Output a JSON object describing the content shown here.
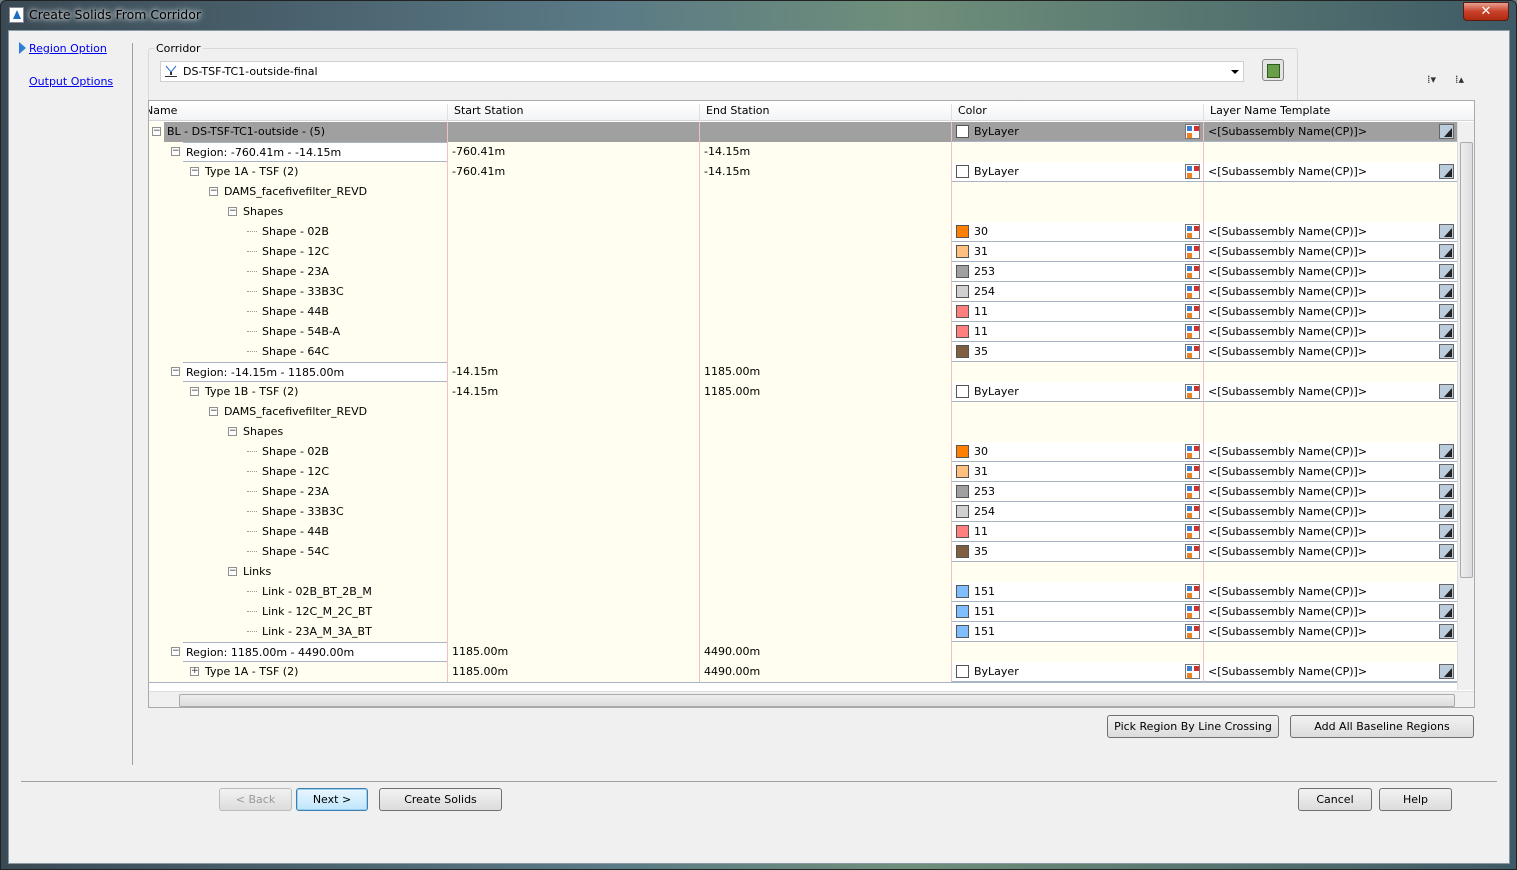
{
  "window": {
    "title": "Create Solids From Corridor",
    "close_label": "✕"
  },
  "nav": {
    "items": [
      {
        "label": "Region Option",
        "active": true
      },
      {
        "label": "Output Options",
        "active": false
      }
    ]
  },
  "corridor": {
    "group_label": "Corridor",
    "value": "DS-TSF-TC1-outside-final"
  },
  "toolbar": {
    "expand_all": "expand-all-icon",
    "collapse_all": "collapse-all-icon"
  },
  "grid": {
    "columns": [
      "Name",
      "Start Station",
      "End Station",
      "Color",
      "Layer Name Template"
    ],
    "rows": [
      {
        "level": 0,
        "label": "BL - DS-TSF-TC1-outside - (5)",
        "exp": "−",
        "selected": true,
        "color": {
          "label": "ByLayer",
          "swatch": "#ffffff"
        },
        "layer": "<[Subassembly Name(CP)]>"
      },
      {
        "level": 1,
        "label": "Region: -760.41m - -14.15m",
        "exp": "−",
        "region": true,
        "start": "-760.41m",
        "end": "-14.15m"
      },
      {
        "level": 2,
        "label": "Type 1A - TSF (2)",
        "exp": "−",
        "start": "-760.41m",
        "end": "-14.15m",
        "color": {
          "label": "ByLayer",
          "swatch": "#ffffff"
        },
        "layer": "<[Subassembly Name(CP)]>"
      },
      {
        "level": 3,
        "label": "DAMS_facefivefilter_REVD",
        "exp": "−"
      },
      {
        "level": 4,
        "label": "Shapes",
        "exp": "−"
      },
      {
        "level": 5,
        "label": "Shape - 02B",
        "color": {
          "label": "30",
          "swatch": "#ff7f00"
        },
        "layer": "<[Subassembly Name(CP)]>"
      },
      {
        "level": 5,
        "label": "Shape - 12C",
        "color": {
          "label": "31",
          "swatch": "#ffbf7f"
        },
        "layer": "<[Subassembly Name(CP)]>"
      },
      {
        "level": 5,
        "label": "Shape - 23A",
        "color": {
          "label": "253",
          "swatch": "#a0a0a0"
        },
        "layer": "<[Subassembly Name(CP)]>"
      },
      {
        "level": 5,
        "label": "Shape - 33B3C",
        "color": {
          "label": "254",
          "swatch": "#d0d0d0"
        },
        "layer": "<[Subassembly Name(CP)]>"
      },
      {
        "level": 5,
        "label": "Shape - 44B",
        "color": {
          "label": "11",
          "swatch": "#ff7f7f"
        },
        "layer": "<[Subassembly Name(CP)]>"
      },
      {
        "level": 5,
        "label": "Shape - 54B-A",
        "color": {
          "label": "11",
          "swatch": "#ff7f7f"
        },
        "layer": "<[Subassembly Name(CP)]>"
      },
      {
        "level": 5,
        "label": "Shape - 64C",
        "color": {
          "label": "35",
          "swatch": "#7f5f3f"
        },
        "layer": "<[Subassembly Name(CP)]>"
      },
      {
        "level": 1,
        "label": "Region: -14.15m - 1185.00m",
        "exp": "−",
        "region": true,
        "start": "-14.15m",
        "end": "1185.00m"
      },
      {
        "level": 2,
        "label": "Type 1B - TSF (2)",
        "exp": "−",
        "start": "-14.15m",
        "end": "1185.00m",
        "color": {
          "label": "ByLayer",
          "swatch": "#ffffff"
        },
        "layer": "<[Subassembly Name(CP)]>"
      },
      {
        "level": 3,
        "label": "DAMS_facefivefilter_REVD",
        "exp": "−"
      },
      {
        "level": 4,
        "label": "Shapes",
        "exp": "−"
      },
      {
        "level": 5,
        "label": "Shape - 02B",
        "color": {
          "label": "30",
          "swatch": "#ff7f00"
        },
        "layer": "<[Subassembly Name(CP)]>"
      },
      {
        "level": 5,
        "label": "Shape - 12C",
        "color": {
          "label": "31",
          "swatch": "#ffbf7f"
        },
        "layer": "<[Subassembly Name(CP)]>"
      },
      {
        "level": 5,
        "label": "Shape - 23A",
        "color": {
          "label": "253",
          "swatch": "#a0a0a0"
        },
        "layer": "<[Subassembly Name(CP)]>"
      },
      {
        "level": 5,
        "label": "Shape - 33B3C",
        "color": {
          "label": "254",
          "swatch": "#d0d0d0"
        },
        "layer": "<[Subassembly Name(CP)]>"
      },
      {
        "level": 5,
        "label": "Shape - 44B",
        "color": {
          "label": "11",
          "swatch": "#ff7f7f"
        },
        "layer": "<[Subassembly Name(CP)]>"
      },
      {
        "level": 5,
        "label": "Shape - 54C",
        "color": {
          "label": "35",
          "swatch": "#7f5f3f"
        },
        "layer": "<[Subassembly Name(CP)]>"
      },
      {
        "level": 4,
        "label": "Links",
        "exp": "−"
      },
      {
        "level": 5,
        "label": "Link - 02B_BT_2B_M",
        "color": {
          "label": "151",
          "swatch": "#7fbfff"
        },
        "layer": "<[Subassembly Name(CP)]>"
      },
      {
        "level": 5,
        "label": "Link - 12C_M_2C_BT",
        "color": {
          "label": "151",
          "swatch": "#7fbfff"
        },
        "layer": "<[Subassembly Name(CP)]>"
      },
      {
        "level": 5,
        "label": "Link - 23A_M_3A_BT",
        "color": {
          "label": "151",
          "swatch": "#7fbfff"
        },
        "layer": "<[Subassembly Name(CP)]>"
      },
      {
        "level": 1,
        "label": "Region: 1185.00m - 4490.00m",
        "exp": "−",
        "region": true,
        "start": "1185.00m",
        "end": "4490.00m"
      },
      {
        "level": 2,
        "label": "Type 1A - TSF (2)",
        "exp": "+",
        "start": "1185.00m",
        "end": "4490.00m",
        "color": {
          "label": "ByLayer",
          "swatch": "#ffffff"
        },
        "layer": "<[Subassembly Name(CP)]>"
      }
    ]
  },
  "actions": {
    "pick_region": "Pick Region By Line Crossing",
    "add_all": "Add All Baseline Regions"
  },
  "footer": {
    "back": "< Back",
    "next": "Next >",
    "create": "Create Solids",
    "cancel": "Cancel",
    "help": "Help"
  }
}
